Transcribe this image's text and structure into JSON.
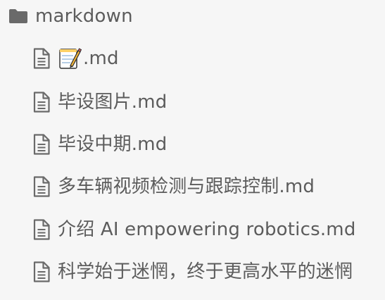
{
  "sidebar": {
    "folder": {
      "name": "markdown",
      "icon": "folder-icon"
    },
    "files": [
      {
        "label": ".md",
        "prefix_icon": "memo-emoji"
      },
      {
        "label": "毕设图片.md"
      },
      {
        "label": "毕设中期.md"
      },
      {
        "label": "多车辆视频检测与跟踪控制.md"
      },
      {
        "label": "介绍 AI empowering robotics.md"
      },
      {
        "label": "科学始于迷惘，终于更高水平的迷惘"
      }
    ]
  },
  "colors": {
    "background": "#f6f6f6",
    "text": "#5c5c5c",
    "icon": "#6a6a6a"
  }
}
